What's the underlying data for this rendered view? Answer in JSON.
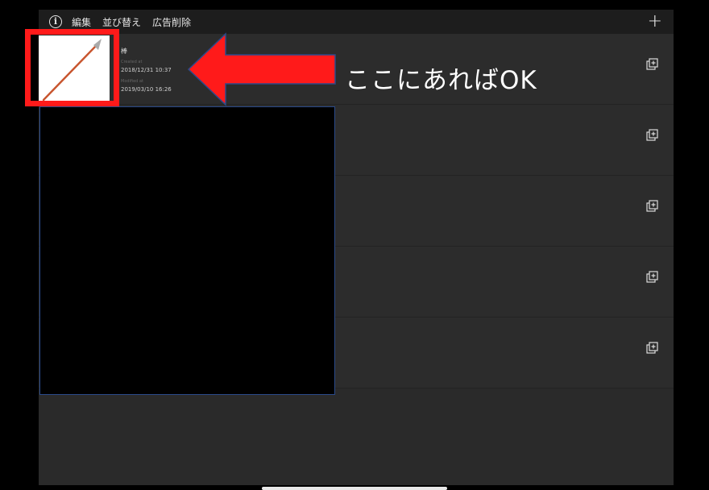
{
  "toolbar": {
    "edit_label": "編集",
    "sort_label": "並び替え",
    "remove_ads_label": "広告削除"
  },
  "rows": [
    {
      "name": "棒",
      "created_label": "Created at",
      "created": "2018/12/31 10:37",
      "modified_label": "Modified at",
      "modified": "2019/03/10 16:26"
    },
    {},
    {},
    {},
    {}
  ],
  "annotation": {
    "callout": "ここにあればOK",
    "highlight_color": "#ff1a1a"
  }
}
